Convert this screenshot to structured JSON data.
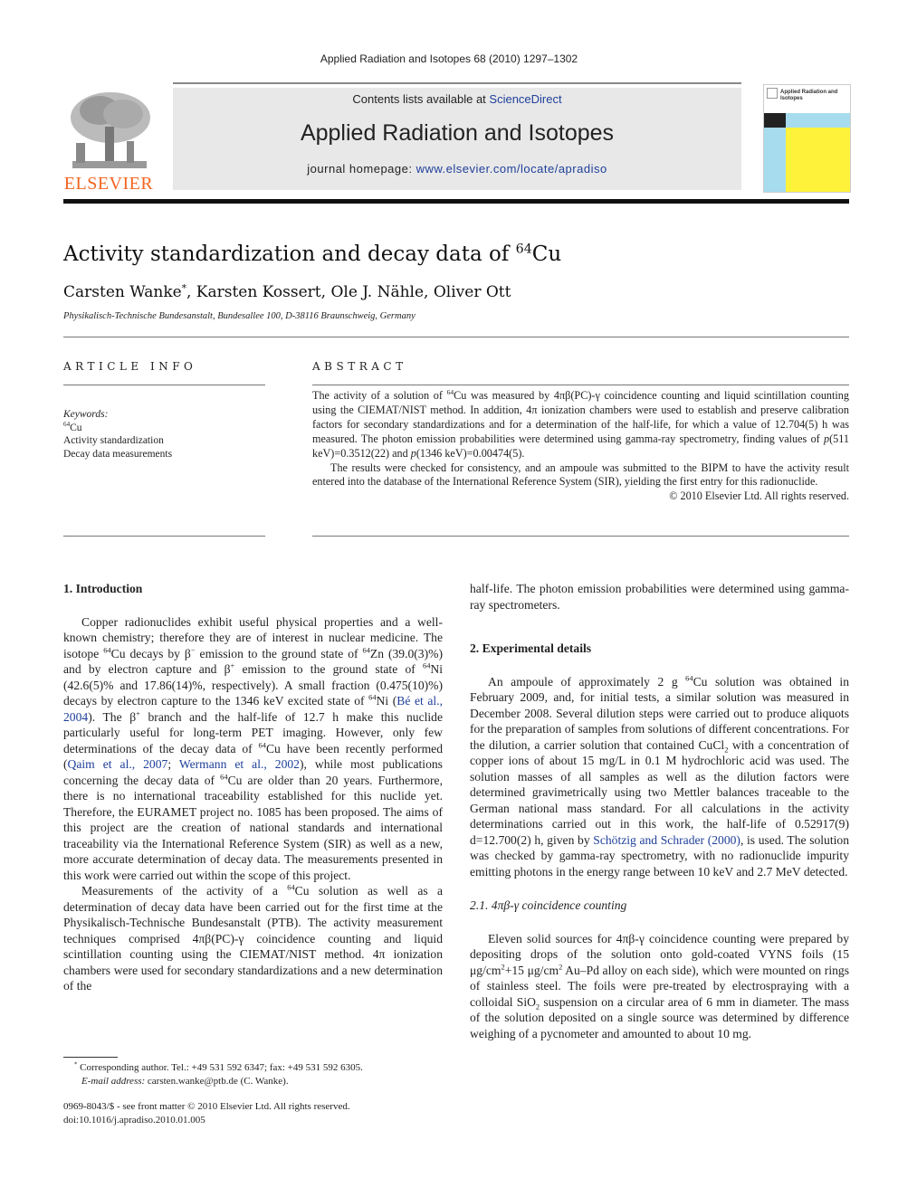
{
  "header": {
    "running_head": "Applied Radiation and Isotopes 68 (2010) 1297–1302",
    "contents_prefix": "Contents lists available at ",
    "contents_link": "ScienceDirect",
    "journal_name": "Applied Radiation and Isotopes",
    "homepage_prefix": "journal homepage: ",
    "homepage_link": "www.elsevier.com/locate/apradiso",
    "publisher_logo_text": "ELSEVIER",
    "cover_title": "Applied Radiation and Isotopes",
    "colors": {
      "publisher": "#f26522",
      "link": "#1f3f9a",
      "cover_blue": "#a6dcee",
      "cover_yellow": "#fff23a"
    }
  },
  "article": {
    "title_prefix": "Activity standardization and decay data of ",
    "title_sup": "64",
    "title_suffix": "Cu",
    "authors_first": "Carsten Wanke",
    "authors_star": "*",
    "authors_rest": ", Karsten Kossert, Ole J. Nähle, Oliver Ott",
    "affiliation": "Physikalisch-Technische Bundesanstalt, Bundesallee 100, D-38116 Braunschweig, Germany"
  },
  "article_info": {
    "heading": "ARTICLE INFO",
    "keywords_label": "Keywords:",
    "keywords": [
      {
        "sup": "64",
        "text": "Cu"
      },
      {
        "sup": "",
        "text": "Activity standardization"
      },
      {
        "sup": "",
        "text": "Decay data measurements"
      }
    ]
  },
  "abstract": {
    "heading": "ABSTRACT",
    "p1_a": "The activity of a solution of ",
    "p1_b": "Cu was measured by 4πβ(PC)-γ coincidence counting and liquid scintillation counting using the CIEMAT/NIST method. In addition, 4π ionization chambers were used to establish and preserve calibration factors for secondary standardizations and for a determination of the half-life, for which a value of 12.704(5) h was measured. The photon emission probabilities were determined using gamma-ray spectrometry, finding values of ",
    "p1_c": "p",
    "p1_d": "(511 keV)=0.3512(22) and ",
    "p1_e": "p",
    "p1_f": "(1346 keV)=0.00474(5).",
    "p2": "The results were checked for consistency, and an ampoule was submitted to the BIPM to have the activity result entered into the database of the International Reference System (SIR), yielding the first entry for this radionuclide.",
    "copyright": "© 2010 Elsevier Ltd. All rights reserved."
  },
  "intro": {
    "heading": "1.  Introduction",
    "p1": [
      "Copper radionuclides exhibit useful physical properties and a well-known chemistry; therefore they are of interest in nuclear medicine. The isotope ",
      "Cu decays by β",
      " emission to the ground state of ",
      "Zn (39.0(3)%) and by electron capture and β",
      " emission to the ground state of ",
      "Ni (42.6(5)% and 17.86(14)%, respectively). A small fraction (0.475(10)%) decays by electron capture to the 1346 keV excited state of ",
      "Ni (",
      "Bé et al., 2004",
      "). The β",
      " branch and the half-life of 12.7 h make this nuclide particularly useful for long-term PET imaging. However, only few determinations of the decay data of ",
      "Cu have been recently performed (",
      "Qaim et al., 2007",
      "; ",
      "Wermann et al., 2002",
      "), while most publications concerning the decay data of ",
      "Cu are older than 20 years. Furthermore, there is no international traceability established for this nuclide yet. Therefore, the EURAMET project no. 1085 has been proposed. The aims of this project are the creation of national standards and international traceability via the International Reference System (SIR) as well as a new, more accurate determination of decay data. The measurements presented in this work were carried out within the scope of this project."
    ],
    "p2_a": "Measurements of the activity of a ",
    "p2_b": "Cu solution as well as a determination of decay data have been carried out for the first time at the Physikalisch-Technische Bundesanstalt (PTB). The activity measurement techniques comprised 4πβ(PC)-γ coincidence counting and liquid scintillation counting using the CIEMAT/NIST method. 4π ionization chambers were used for secondary standardizations and a new determination of the",
    "p3": "half-life. The photon emission probabilities were determined using gamma-ray spectrometers.",
    "sup64": "64",
    "minus": "−",
    "plus": "+"
  },
  "experimental": {
    "heading": "2.  Experimental details",
    "p1": [
      "An ampoule of approximately 2 g ",
      "Cu solution was obtained in February 2009, and, for initial tests, a similar solution was measured in December 2008. Several dilution steps were carried out to produce aliquots for the preparation of samples from solutions of different concentrations. For the dilution, a carrier solution that contained CuCl",
      " with a concentration of copper ions of about 15 mg/L in 0.1 M hydrochloric acid was used. The solution masses of all samples as well as the dilution factors were determined gravimetrically using two Mettler balances traceable to the German national mass standard. For all calculations in the activity determinations carried out in this work, the half-life of 0.52917(9) d=12.700(2) h, given by ",
      "Schötzig and Schrader (2000)",
      ", is used. The solution was checked by gamma-ray spectrometry, with no radionuclide impurity emitting photons in the energy range between 10 keV and 2.7 MeV detected."
    ],
    "sub2": "2",
    "subsection_heading": "2.1.  4πβ-γ coincidence counting",
    "p2": [
      "Eleven solid sources for 4πβ-γ coincidence counting were prepared by depositing drops of the solution onto gold-coated VYNS foils (15 μg/cm",
      "+15 μg/cm",
      " Au–Pd alloy on each side), which were mounted on rings of stainless steel. The foils were pre-treated by electrospraying with a colloidal SiO",
      " suspension on a circular area of 6 mm in diameter. The mass of the solution deposited on a single source was determined by difference weighing of a pycnometer and amounted to about 10 mg."
    ]
  },
  "footnotes": {
    "star": "*",
    "corresponding": " Corresponding author. Tel.: +49 531 592 6347; fax: +49 531 592 6305.",
    "email_label": "E-mail address:",
    "email": " carsten.wanke@ptb.de (C. Wanke).",
    "issn": "0969-8043/$ - see front matter © 2010 Elsevier Ltd. All rights reserved.",
    "doi": "doi:10.1016/j.apradiso.2010.01.005"
  }
}
